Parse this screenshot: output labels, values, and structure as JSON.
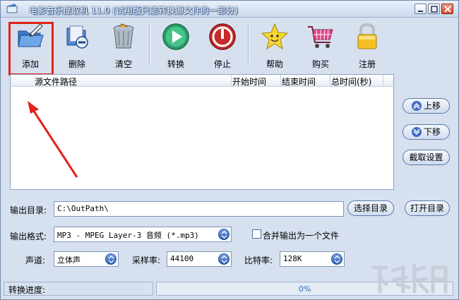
{
  "window": {
    "title": "电影音乐提取机 11.0 (试用版只能转换源文件的一部分)"
  },
  "toolbar": {
    "items": [
      {
        "label": "添加",
        "icon": "folder-add-icon"
      },
      {
        "label": "删除",
        "icon": "delete-file-icon"
      },
      {
        "label": "清空",
        "icon": "trash-bin-icon"
      },
      {
        "label": "转换",
        "icon": "play-icon"
      },
      {
        "label": "停止",
        "icon": "stop-icon"
      },
      {
        "label": "帮助",
        "icon": "star-face-icon"
      },
      {
        "label": "购买",
        "icon": "shopping-cart-icon"
      },
      {
        "label": "注册",
        "icon": "padlock-icon"
      }
    ]
  },
  "file_list": {
    "columns": [
      "源文件路径",
      "开始时间",
      "结束时间",
      "总时间(秒)"
    ]
  },
  "side_buttons": {
    "up": "上移",
    "down": "下移",
    "trim": "截取设置",
    "open_dir": "打开目录"
  },
  "output": {
    "dir_label": "输出目录:",
    "dir_value": "C:\\OutPath\\",
    "browse": "选择目录",
    "format_label": "输出格式:",
    "format_value": "MP3 - MPEG Layer-3 音频 (*.mp3)",
    "merge_label": "合并输出为一个文件",
    "channel_label": "声道:",
    "channel_value": "立体声",
    "sample_label": "采样率:",
    "sample_value": "44100",
    "bitrate_label": "比特率:",
    "bitrate_value": "128K"
  },
  "status": {
    "progress_label": "转换进度:",
    "progress_text": "0%",
    "progress": 0
  },
  "colors": {
    "annotation": "#e3221b",
    "accent": "#3e6cc4"
  }
}
